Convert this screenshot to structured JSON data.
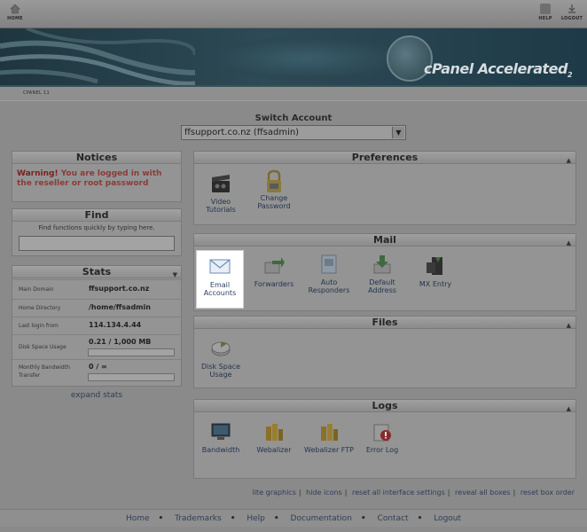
{
  "topbar": {
    "home_label": "HOME",
    "help_label": "HELP",
    "logout_label": "LOGOUT"
  },
  "banner": {
    "logo_text": "cPanel Accelerated",
    "logo_sub": "2"
  },
  "breadcrumb": "CPANEL 11",
  "switch_account": {
    "label": "Switch Account",
    "selected": "ffsupport.co.nz (ffsadmin)"
  },
  "notices": {
    "title": "Notices",
    "warning_label": "Warning!",
    "message": "You are logged in with the reseller or root password"
  },
  "find": {
    "title": "Find",
    "hint": "Find functions quickly by typing here."
  },
  "stats": {
    "title": "Stats",
    "rows": [
      {
        "key": "Main Domain",
        "value": "ffsupport.co.nz"
      },
      {
        "key": "Home Directory",
        "value": "/home/ffsadmin"
      },
      {
        "key": "Last login from",
        "value": "114.134.4.44"
      },
      {
        "key": "Disk Space Usage",
        "value": "0.21 / 1,000 MB"
      },
      {
        "key": "Monthly Bandwidth Transfer",
        "value": "0 / ∞"
      }
    ],
    "expand_label": "expand stats"
  },
  "preferences": {
    "title": "Preferences",
    "items": [
      {
        "label": "Video Tutorials",
        "icon": "clapperboard-icon"
      },
      {
        "label": "Change Password",
        "icon": "padlock-icon"
      }
    ]
  },
  "mail": {
    "title": "Mail",
    "items": [
      {
        "label": "Email Accounts",
        "icon": "envelope-icon"
      },
      {
        "label": "Forwarders",
        "icon": "forward-arrow-icon"
      },
      {
        "label": "Auto Responders",
        "icon": "auto-responder-icon"
      },
      {
        "label": "Default Address",
        "icon": "download-arrow-icon"
      },
      {
        "label": "MX Entry",
        "icon": "mx-entry-icon"
      }
    ]
  },
  "files": {
    "title": "Files",
    "items": [
      {
        "label": "Disk Space Usage",
        "icon": "disk-usage-icon"
      }
    ]
  },
  "logs": {
    "title": "Logs",
    "items": [
      {
        "label": "Bandwidth",
        "icon": "monitor-icon"
      },
      {
        "label": "Webalizer",
        "icon": "webalizer-icon"
      },
      {
        "label": "Webalizer FTP",
        "icon": "webalizer-ftp-icon"
      },
      {
        "label": "Error Log",
        "icon": "error-log-icon"
      }
    ]
  },
  "footer_links": [
    "lite graphics",
    "hide icons",
    "reset all interface settings",
    "reveal all boxes",
    "reset box order"
  ],
  "footer_nav": [
    "Home",
    "Trademarks",
    "Help",
    "Documentation",
    "Contact",
    "Logout"
  ],
  "colors": {
    "link": "#2e3e55",
    "warning": "#7a2020",
    "highlight": "#ffffff"
  }
}
